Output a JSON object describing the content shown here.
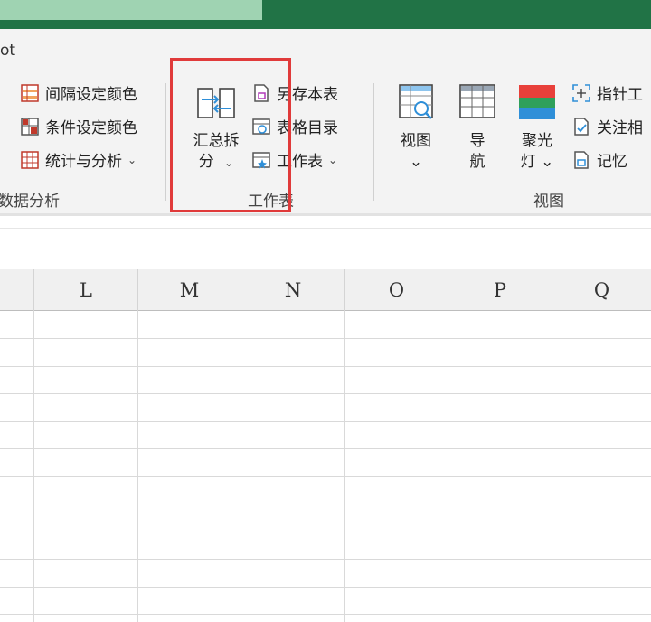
{
  "tab": {
    "partial_label": "ot"
  },
  "left_group": {
    "items": [
      {
        "label": "间隔设定颜色",
        "icon": "alternate-color-grid-icon"
      },
      {
        "label": "条件设定颜色",
        "icon": "conditional-color-grid-icon"
      },
      {
        "label": "统计与分析",
        "icon": "statistics-analysis-icon",
        "chevron": "⌄"
      }
    ],
    "group_label": "数据分析"
  },
  "worksheet_group": {
    "big_button": {
      "line1": "汇总拆",
      "line2": "分",
      "chevron": "⌄",
      "icon": "merge-split-icon"
    },
    "items": [
      {
        "label": "另存本表",
        "icon": "save-sheet-icon"
      },
      {
        "label": "表格目录",
        "icon": "table-directory-icon"
      },
      {
        "label": "工作表",
        "icon": "worksheet-icon",
        "chevron": "⌄"
      }
    ],
    "group_label": "工作表"
  },
  "view_group": {
    "buttons": [
      {
        "line1": "视图",
        "line2": "⌄",
        "icon": "view-search-icon"
      },
      {
        "line1": "导",
        "line2": "航",
        "icon": "navigation-grid-icon"
      },
      {
        "line1": "聚光",
        "line2": "灯 ⌄",
        "icon": "spotlight-icon"
      }
    ],
    "items": [
      {
        "label": "指针工",
        "icon": "pointer-tool-icon"
      },
      {
        "label": "关注相",
        "icon": "focus-related-icon"
      },
      {
        "label": "记忆",
        "icon": "memory-icon"
      }
    ],
    "group_label": "视图"
  },
  "columns": [
    "L",
    "M",
    "N",
    "O",
    "P",
    "Q"
  ],
  "colors": {
    "title_bar": "#217346",
    "highlight_border": "#e03a3a",
    "spotlight_red": "#e8403a",
    "spotlight_green": "#2fa05a",
    "spotlight_blue": "#2f8fd8"
  }
}
